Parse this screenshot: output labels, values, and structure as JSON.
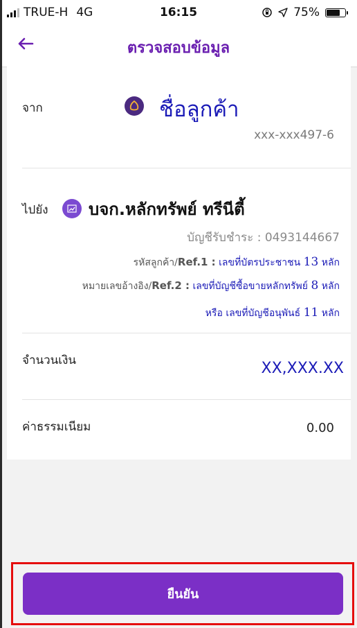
{
  "status_bar": {
    "carrier": "TRUE-H",
    "network": "4G",
    "time": "16:15",
    "battery": "75%",
    "battery_level": 0.75
  },
  "header": {
    "title": "ตรวจสอบข้อมูล"
  },
  "from": {
    "label": "จาก",
    "name": "ชื่อลูกค้า",
    "account": "xxx-xxx497-6",
    "icon": "bank-logo-icon"
  },
  "to": {
    "label": "ไปยัง",
    "name": "บจก.หลักทรัพย์ ทรีนีตี้",
    "account": "บัญชีรับชำระ : 0493144667",
    "icon": "stock-chart-icon",
    "ref1": {
      "prefix": "รหัสลูกค้า/",
      "key": "Ref.1 :",
      "text": " เลขที่บัตรประชาชน ",
      "digits": "13",
      "suffix": " หลัก"
    },
    "ref2": {
      "prefix": "หมายเลขอ้างอิง/",
      "key": "Ref.2 :",
      "text": " เลขที่บัญชีซื้อขายหลักทรัพย์ ",
      "digits": "8",
      "suffix": " หลัก"
    },
    "ref2_alt": {
      "prefix": "หรือ เลขที่บัญชีอนุพันธ์ ",
      "digits": "11",
      "suffix": " หลัก"
    }
  },
  "amount": {
    "label": "จำนวนเงิน",
    "value": "XX,XXX.XX"
  },
  "fee": {
    "label": "ค่าธรรมเนียม",
    "value": "0.00"
  },
  "actions": {
    "confirm_label": "ยืนยัน"
  },
  "colors": {
    "accent": "#7b2fc6",
    "header_title": "#6a1fb0",
    "highlight": "#e50d0d",
    "blue_text": "#1b1bb7"
  }
}
